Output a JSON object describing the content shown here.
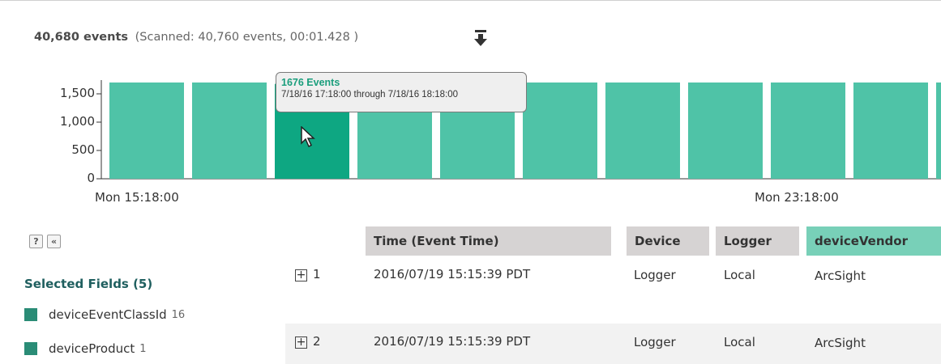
{
  "summary": {
    "events": "40,680 events",
    "scanned": "(Scanned: 40,760 events,  00:01.428 )"
  },
  "download_icon": "download-arrow-icon",
  "chart_data": {
    "type": "bar",
    "categories": [
      "Mon 15:18:00",
      "",
      "",
      "",
      "",
      "",
      "",
      "",
      "Mon 23:18:00",
      "",
      "",
      ""
    ],
    "values": [
      1700,
      1700,
      1676,
      1700,
      1700,
      1700,
      1700,
      1700,
      1700,
      1700,
      1700,
      1700
    ],
    "highlighted_index": 2,
    "yticks": [
      "1,500",
      "1,000",
      "500",
      "0"
    ],
    "ytick_values": [
      1500,
      1000,
      500,
      0
    ],
    "xticks": [
      "Mon 15:18:00",
      "Mon 23:18:00"
    ],
    "ylim": [
      0,
      1700
    ],
    "bar_color": "#4fc3a7",
    "highlight_color": "#0ea782"
  },
  "tooltip": {
    "title": "1676 Events",
    "range": "7/18/16 17:18:00 through 7/18/16 18:18:00"
  },
  "panel": {
    "help_label": "?",
    "collapse_label": "«",
    "selected_title": "Selected Fields (5)",
    "fields": [
      {
        "name": "deviceEventClassId",
        "count": "16"
      },
      {
        "name": "deviceProduct",
        "count": "1"
      }
    ]
  },
  "table": {
    "columns": [
      "Time (Event Time)",
      "Device",
      "Logger",
      "deviceVendor"
    ],
    "rows": [
      {
        "num": "1",
        "time": "2016/07/19 15:15:39 PDT",
        "device": "Logger",
        "logger": "Local",
        "vendor": "ArcSight"
      },
      {
        "num": "2",
        "time": "2016/07/19 15:15:39 PDT",
        "device": "Logger",
        "logger": "Local",
        "vendor": "ArcSight"
      }
    ]
  },
  "colors": {
    "header_gray": "#d6d3d3",
    "header_vendor": "#78d0b8",
    "row_alt": "#f2f2f2",
    "field_swatch": "#2a8c76"
  }
}
